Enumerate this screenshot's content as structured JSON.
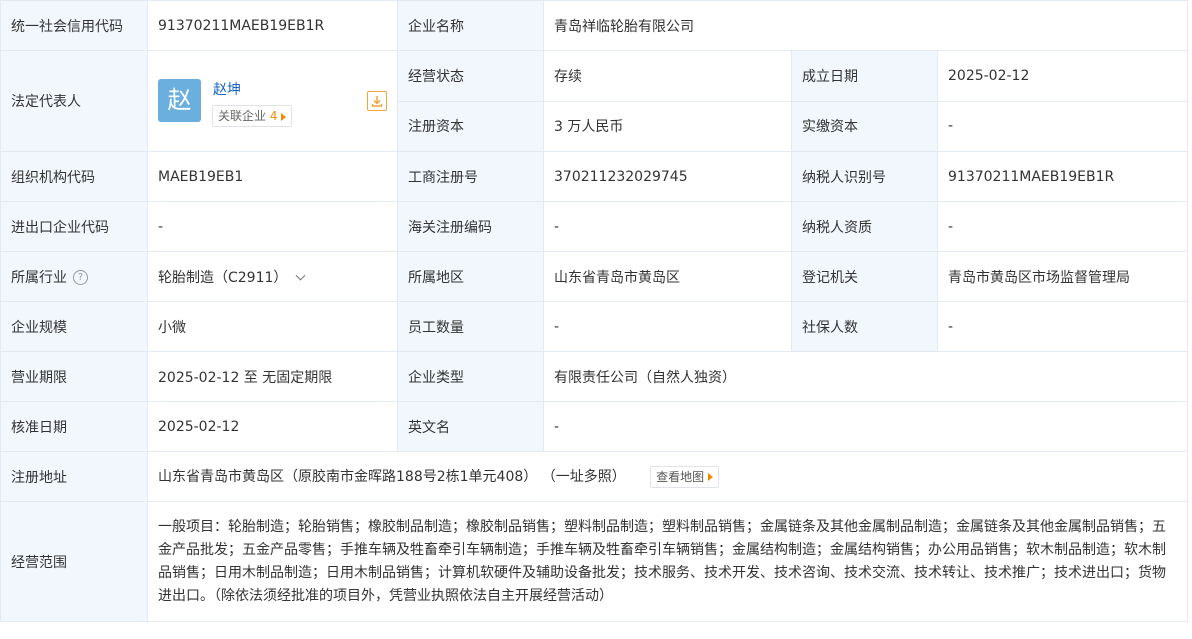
{
  "rows": {
    "credit_code": {
      "label": "统一社会信用代码",
      "value": "91370211MAEB19EB1R"
    },
    "company_name": {
      "label": "企业名称",
      "value": "青岛祥临轮胎有限公司"
    },
    "legal_rep": {
      "label": "法定代表人",
      "avatar_char": "赵",
      "name": "赵坤",
      "related_label": "关联企业",
      "related_count": "4"
    },
    "status": {
      "label": "经营状态",
      "value": "存续"
    },
    "founded": {
      "label": "成立日期",
      "value": "2025-02-12"
    },
    "reg_capital": {
      "label": "注册资本",
      "value": "3 万人民币"
    },
    "paid_capital": {
      "label": "实缴资本",
      "value": "-"
    },
    "org_code": {
      "label": "组织机构代码",
      "value": "MAEB19EB1"
    },
    "biz_reg_no": {
      "label": "工商注册号",
      "value": "370211232029745"
    },
    "taxpayer_id": {
      "label": "纳税人识别号",
      "value": "91370211MAEB19EB1R"
    },
    "import_export_code": {
      "label": "进出口企业代码",
      "value": "-"
    },
    "customs_code": {
      "label": "海关注册编码",
      "value": "-"
    },
    "taxpayer_qual": {
      "label": "纳税人资质",
      "value": "-"
    },
    "industry": {
      "label": "所属行业",
      "help_icon": "?",
      "value": "轮胎制造（C2911）"
    },
    "region": {
      "label": "所属地区",
      "value": "山东省青岛市黄岛区"
    },
    "reg_authority": {
      "label": "登记机关",
      "value": "青岛市黄岛区市场监督管理局"
    },
    "scale": {
      "label": "企业规模",
      "value": "小微"
    },
    "employees": {
      "label": "员工数量",
      "value": "-"
    },
    "social_security": {
      "label": "社保人数",
      "value": "-"
    },
    "term": {
      "label": "营业期限",
      "value": "2025-02-12 至 无固定期限"
    },
    "company_type": {
      "label": "企业类型",
      "value": "有限责任公司（自然人独资）"
    },
    "approval_date": {
      "label": "核准日期",
      "value": "2025-02-12"
    },
    "english_name": {
      "label": "英文名",
      "value": "-"
    },
    "address": {
      "label": "注册地址",
      "value": "山东省青岛市黄岛区（原胶南市金晖路188号2栋1单元408）",
      "extra": "（一址多照）",
      "map_btn": "查看地图"
    },
    "scope": {
      "label": "经营范围",
      "value": "一般项目：轮胎制造；轮胎销售；橡胶制品制造；橡胶制品销售；塑料制品制造；塑料制品销售；金属链条及其他金属制品制造；金属链条及其他金属制品销售；五金产品批发；五金产品零售；手推车辆及牲畜牵引车辆制造；手推车辆及牲畜牵引车辆销售；金属结构制造；金属结构销售；办公用品销售；软木制品制造；软木制品销售；日用木制品制造；日用木制品销售；计算机软硬件及辅助设备批发；技术服务、技术开发、技术咨询、技术交流、技术转让、技术推广；技术进出口；货物进出口。（除依法须经批准的项目外，凭营业执照依法自主开展经营活动）"
    }
  },
  "colors": {
    "label_bg": "#f2f7fd",
    "border": "#e4eaf2",
    "link": "#1864c7",
    "accent": "#f28a00",
    "avatar_bg": "#6bafdf"
  },
  "icons": {
    "download": "download-icon",
    "help": "question-icon",
    "chevron": "chevron-down-icon",
    "arrow": "caret-right-icon"
  }
}
